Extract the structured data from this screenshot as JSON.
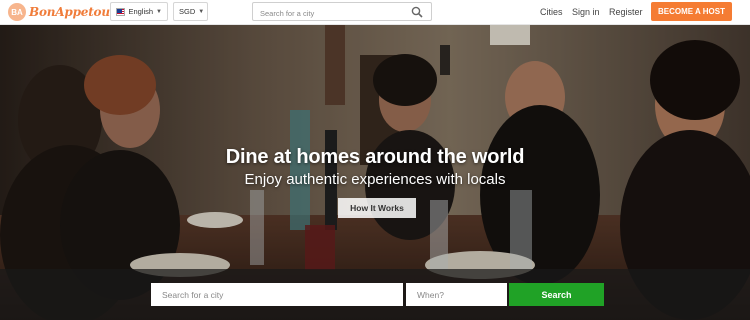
{
  "brand": {
    "logo_text": "BonAppetour",
    "logo_badge": "BA"
  },
  "header": {
    "language": "English",
    "currency": "SGD",
    "search_placeholder": "Search for a city",
    "nav": [
      "Cities",
      "Sign in",
      "Register"
    ],
    "host_button": "BECOME A HOST"
  },
  "hero": {
    "title": "Dine at homes around the world",
    "subtitle": "Enjoy authentic experiences with locals",
    "how_button": "How It Works"
  },
  "search": {
    "city_placeholder": "Search for a city",
    "when_placeholder": "When?",
    "button": "Search"
  },
  "colors": {
    "brand_orange": "#f57c33",
    "search_green": "#20a226"
  }
}
